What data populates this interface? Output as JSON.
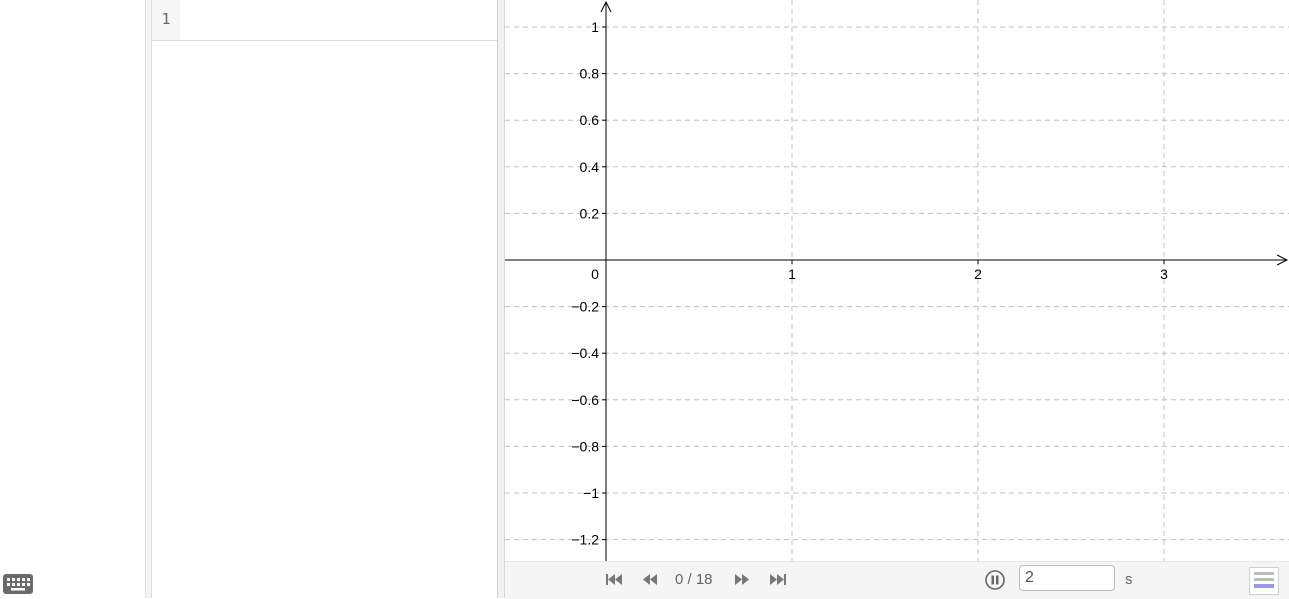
{
  "algebra": {
    "row_number": "1"
  },
  "graph": {
    "x_ticks": [
      "0",
      "1",
      "2",
      "3"
    ],
    "y_ticks": [
      {
        "value": 1,
        "label": "1"
      },
      {
        "value": 0.8,
        "label": "0.8"
      },
      {
        "value": 0.6,
        "label": "0.6"
      },
      {
        "value": 0.4,
        "label": "0.4"
      },
      {
        "value": 0.2,
        "label": "0.2"
      },
      {
        "value": -0.2,
        "label": "−0.2"
      },
      {
        "value": -0.4,
        "label": "−0.4"
      },
      {
        "value": -0.6,
        "label": "−0.6"
      },
      {
        "value": -0.8,
        "label": "−0.8"
      },
      {
        "value": -1,
        "label": "−1"
      },
      {
        "value": -1.2,
        "label": "−1.2"
      }
    ],
    "x_tick_values": [
      1,
      2,
      3
    ],
    "grid": true,
    "colors": {
      "axis": "#000000",
      "grid": "#c0c0c0"
    }
  },
  "playbar": {
    "counter": "0 / 18",
    "speed_value": "2",
    "speed_unit": "s",
    "icons": [
      "first-icon",
      "previous-icon",
      "next-icon",
      "last-icon",
      "pause-icon",
      "algebra-view-icon"
    ]
  },
  "keyboard": {
    "icon": "keyboard-icon"
  }
}
